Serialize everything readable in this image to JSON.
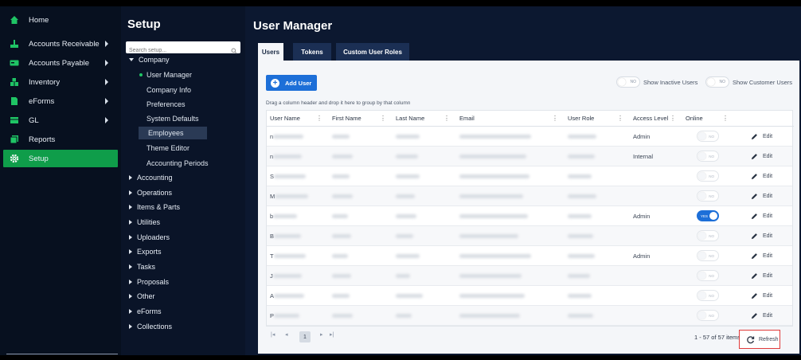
{
  "nav": {
    "items": [
      {
        "label": "Home",
        "icon": "home-icon",
        "has_submenu": false
      },
      {
        "label": "Accounts Receivable",
        "icon": "receivable-icon",
        "has_submenu": true
      },
      {
        "label": "Accounts Payable",
        "icon": "payable-icon",
        "has_submenu": true
      },
      {
        "label": "Inventory",
        "icon": "inventory-icon",
        "has_submenu": true
      },
      {
        "label": "eForms",
        "icon": "eforms-icon",
        "has_submenu": true
      },
      {
        "label": "GL",
        "icon": "gl-icon",
        "has_submenu": true
      },
      {
        "label": "Reports",
        "icon": "reports-icon",
        "has_submenu": false
      },
      {
        "label": "Setup",
        "icon": "gear-icon",
        "has_submenu": false,
        "active": true
      }
    ]
  },
  "setup": {
    "title": "Setup",
    "search_placeholder": "Search setup...",
    "company_label": "Company",
    "company_children": [
      "User Manager",
      "Company Info",
      "Preferences",
      "System Defaults",
      "Employees",
      "Theme Editor",
      "Accounting Periods"
    ],
    "sections": [
      "Accounting",
      "Operations",
      "Items & Parts",
      "Utilities",
      "Uploaders",
      "Exports",
      "Tasks",
      "Proposals",
      "Other",
      "eForms",
      "Collections"
    ]
  },
  "main": {
    "title": "User Manager",
    "tabs": [
      "Users",
      "Tokens",
      "Custom User Roles"
    ],
    "add_user_label": "Add User",
    "toggle_off_text": "NO",
    "toggle_on_text": "YES",
    "show_inactive_label": "Show Inactive Users",
    "show_customer_label": "Show Customer Users",
    "drag_tip": "Drag a column header and drop it here to group by that column",
    "columns": [
      "User Name",
      "First Name",
      "Last Name",
      "Email",
      "User Role",
      "Access Level",
      "Online"
    ],
    "rows": [
      {
        "user_prefix": "n",
        "access": "Admin",
        "online": false
      },
      {
        "user_prefix": "n",
        "access": "Internal",
        "online": false
      },
      {
        "user_prefix": "S",
        "access": "",
        "online": false
      },
      {
        "user_prefix": "M",
        "access": "",
        "online": false
      },
      {
        "user_prefix": "b",
        "access": "Admin",
        "online": true
      },
      {
        "user_prefix": "B",
        "access": "",
        "online": false
      },
      {
        "user_prefix": "T",
        "access": "Admin",
        "online": false
      },
      {
        "user_prefix": "J",
        "access": "",
        "online": false
      },
      {
        "user_prefix": "A",
        "access": "",
        "online": false
      },
      {
        "user_prefix": "P",
        "access": "",
        "online": false
      }
    ],
    "edit_label": "Edit",
    "pager": {
      "current_page": "1",
      "items_text": "1 - 57 of 57 items"
    },
    "refresh_label": "Refresh"
  },
  "colors": {
    "accent_green": "#0f9d4a",
    "accent_blue": "#1d6fd8",
    "highlight_red": "#e03b3b"
  }
}
